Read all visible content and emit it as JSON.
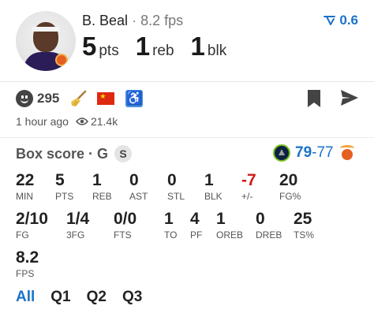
{
  "player": {
    "name": "B. Beal",
    "separator": "·",
    "fps_text": "8.2 fps",
    "fps_trend": "0.6",
    "trend_color": "#1a73c8"
  },
  "headline": [
    {
      "value": "5",
      "unit": "pts"
    },
    {
      "value": "1",
      "unit": "reb"
    },
    {
      "value": "1",
      "unit": "blk"
    }
  ],
  "reactions": {
    "count": "295",
    "icons": [
      "smiley-icon",
      "broom-icon",
      "china-flag-icon",
      "wheelchair-icon"
    ]
  },
  "meta": {
    "time": "1 hour ago",
    "views": "21.4k"
  },
  "box_score": {
    "title": "Box score · G",
    "badge": "S",
    "home_score": "79",
    "dash": "-",
    "away_score": "77"
  },
  "stats": [
    {
      "value": "22",
      "label": "MIN"
    },
    {
      "value": "5",
      "label": "PTS"
    },
    {
      "value": "1",
      "label": "REB"
    },
    {
      "value": "0",
      "label": "AST"
    },
    {
      "value": "0",
      "label": "STL"
    },
    {
      "value": "1",
      "label": "BLK"
    },
    {
      "value": "-7",
      "label": "+/-"
    },
    {
      "value": "20",
      "label": "FG%"
    },
    {
      "value": "2/10",
      "label": "FG"
    },
    {
      "value": "1/4",
      "label": "3FG"
    },
    {
      "value": "0/0",
      "label": "FTS"
    },
    {
      "value": "1",
      "label": "TO"
    },
    {
      "value": "4",
      "label": "PF"
    },
    {
      "value": "1",
      "label": "OREB"
    },
    {
      "value": "0",
      "label": "DREB"
    },
    {
      "value": "25",
      "label": "TS%"
    },
    {
      "value": "8.2",
      "label": "FPS"
    }
  ],
  "tabs": [
    "All",
    "Q1",
    "Q2",
    "Q3"
  ],
  "colors": {
    "accent": "#1a73c8",
    "negative": "#d21a1a"
  }
}
